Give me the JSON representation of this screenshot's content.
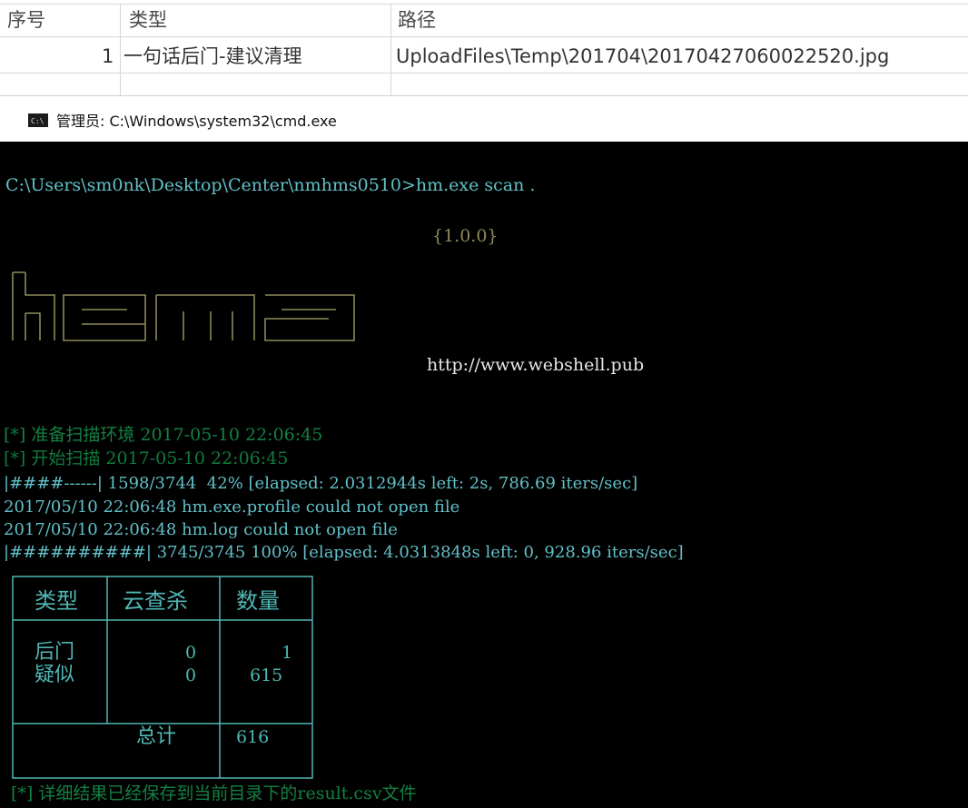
{
  "grid": {
    "headers": [
      "序号",
      "类型",
      "路径"
    ],
    "row": {
      "num": "1",
      "type": "一句话后门-建议清理",
      "path": "UploadFiles\\Temp\\201704\\20170427060022520.jpg"
    }
  },
  "cmd_window": {
    "title": "管理员: C:\\Windows\\system32\\cmd.exe",
    "icon_label": "C:\\"
  },
  "console": {
    "prompt": "C:\\Users\\sm0nk\\Desktop\\Center\\nmhms0510>hm.exe scan .",
    "version": "{1.0.0}",
    "logo_text": "hema",
    "url": "http://www.webshell.pub",
    "lines": [
      "[*] 准备扫描环境 2017-05-10 22:06:45",
      "[*] 开始扫描 2017-05-10 22:06:45",
      "|####------| 1598/3744  42% [elapsed: 2.0312944s left: 2s, 786.69 iters/sec]",
      "2017/05/10 22:06:48 hm.exe.profile could not open file",
      "2017/05/10 22:06:48 hm.log could not open file",
      "|##########| 3745/3745 100% [elapsed: 4.0313848s left: 0, 928.96 iters/sec]"
    ],
    "table": {
      "headers": [
        "类型",
        "云查杀",
        "数量"
      ],
      "rows": [
        {
          "type": "后门",
          "cloud": "0",
          "count": "1"
        },
        {
          "type": "疑似",
          "cloud": "0",
          "count": "615"
        }
      ],
      "total_label": "总计",
      "total_value": "616"
    },
    "footer": "[*] 详细结果已经保存到当前目录下的result.csv文件"
  }
}
